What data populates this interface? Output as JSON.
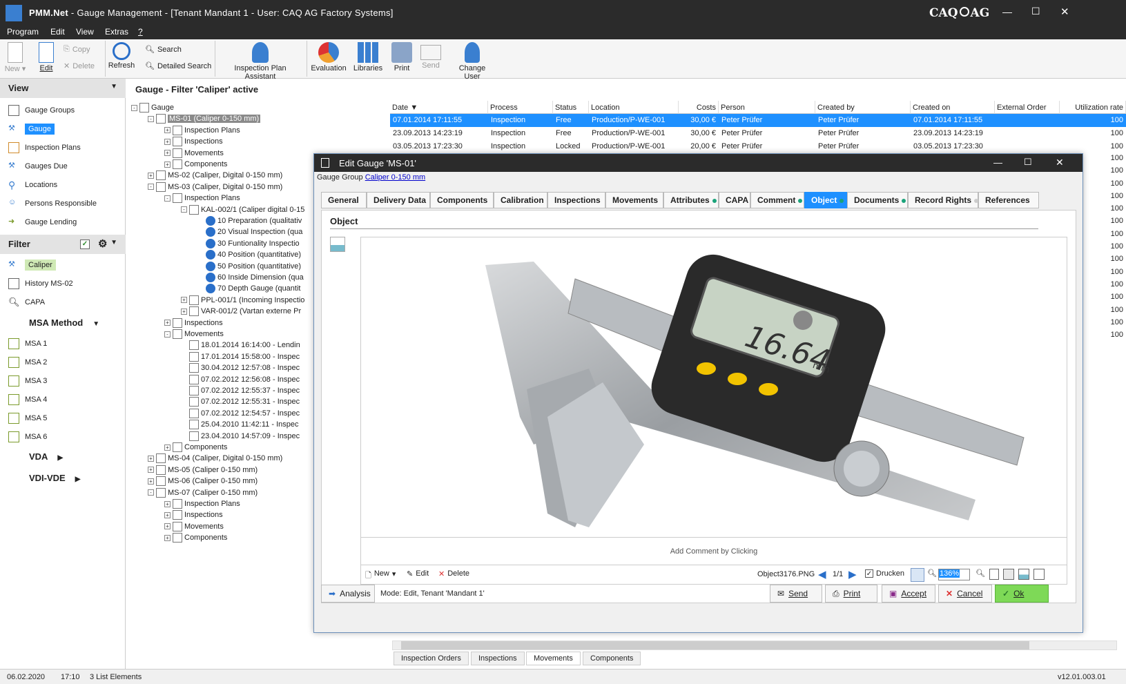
{
  "window": {
    "app": "PMM.Net",
    "title": " - Gauge Management - [Tenant Mandant 1 - User: CAQ AG Factory Systems]",
    "brand_left": "CAQ",
    "brand_right": "AG",
    "min": "—",
    "max": "☐",
    "close": "✕"
  },
  "menu": [
    "Program",
    "Edit",
    "View",
    "Extras",
    "?"
  ],
  "ribbon": {
    "new": "New",
    "edit": "Edit",
    "copy": "Copy",
    "delete": "Delete",
    "refresh": "Refresh",
    "search": "Search",
    "detailed_search": "Detailed Search",
    "assistant": "Inspection Plan Assistant",
    "evaluation": "Evaluation",
    "libraries": "Libraries",
    "print": "Print",
    "send": "Send",
    "change_user": "Change User"
  },
  "view_panel": {
    "title": "View",
    "items": [
      "Gauge Groups",
      "Gauge",
      "Inspection Plans",
      "Gauges Due",
      "Locations",
      "Persons Responsible",
      "Gauge Lending"
    ]
  },
  "filter_panel": {
    "title": "Filter",
    "items": [
      "Caliper",
      "History MS-02",
      "CAPA"
    ],
    "msa": "MSA Method",
    "msa_items": [
      "MSA 1",
      "MSA 2",
      "MSA 3",
      "MSA 4",
      "MSA 5",
      "MSA 6"
    ],
    "vda": "VDA",
    "vdi": "VDI-VDE"
  },
  "heading": "Gauge - Filter 'Caliper' active",
  "tree": [
    {
      "t": "Gauge",
      "l": 0,
      "ex": "-"
    },
    {
      "t": "MS-01 (Caliper 0-150 mm)",
      "l": 1,
      "ex": "-",
      "sel": true
    },
    {
      "t": "Inspection Plans",
      "l": 2,
      "ex": "+"
    },
    {
      "t": "Inspections",
      "l": 2,
      "ex": "+"
    },
    {
      "t": "Movements",
      "l": 2,
      "ex": "+"
    },
    {
      "t": "Components",
      "l": 2,
      "ex": "+"
    },
    {
      "t": "MS-02 (Caliper, Digital 0-150 mm)",
      "l": 1,
      "ex": "+"
    },
    {
      "t": "MS-03 (Caliper, Digital 0-150 mm)",
      "l": 1,
      "ex": "-"
    },
    {
      "t": "Inspection Plans",
      "l": 2,
      "ex": "-"
    },
    {
      "t": "KAL-002/1 (Caliper digital 0-15",
      "l": 3,
      "ex": "-"
    },
    {
      "t": "10 Preparation (qualitativ",
      "l": 4,
      "ex": ""
    },
    {
      "t": "20 Visual Inspection (qua",
      "l": 4,
      "ex": ""
    },
    {
      "t": "30 Funtionality Inspectio",
      "l": 4,
      "ex": ""
    },
    {
      "t": "40 Position (quantitative)",
      "l": 4,
      "ex": ""
    },
    {
      "t": "50 Position (quantitative)",
      "l": 4,
      "ex": ""
    },
    {
      "t": "60 Inside Dimension (qua",
      "l": 4,
      "ex": ""
    },
    {
      "t": "70 Depth Gauge (quantit",
      "l": 4,
      "ex": ""
    },
    {
      "t": "PPL-001/1 (Incoming Inspectio",
      "l": 3,
      "ex": "+"
    },
    {
      "t": "VAR-001/2 (Vartan externe Pr",
      "l": 3,
      "ex": "+"
    },
    {
      "t": "Inspections",
      "l": 2,
      "ex": "+"
    },
    {
      "t": "Movements",
      "l": 2,
      "ex": "-"
    },
    {
      "t": "18.01.2014 16:14:00 - Lendin",
      "l": 3,
      "ex": ""
    },
    {
      "t": "17.01.2014 15:58:00 - Inspec",
      "l": 3,
      "ex": ""
    },
    {
      "t": "30.04.2012 12:57:08 - Inspec",
      "l": 3,
      "ex": ""
    },
    {
      "t": "07.02.2012 12:56:08 - Inspec",
      "l": 3,
      "ex": ""
    },
    {
      "t": "07.02.2012 12:55:37 - Inspec",
      "l": 3,
      "ex": ""
    },
    {
      "t": "07.02.2012 12:55:31 - Inspec",
      "l": 3,
      "ex": ""
    },
    {
      "t": "07.02.2012 12:54:57 - Inspec",
      "l": 3,
      "ex": ""
    },
    {
      "t": "25.04.2010 11:42:11 - Inspec",
      "l": 3,
      "ex": ""
    },
    {
      "t": "23.04.2010 14:57:09 - Inspec",
      "l": 3,
      "ex": ""
    },
    {
      "t": "Components",
      "l": 2,
      "ex": "+"
    },
    {
      "t": "MS-04 (Caliper, Digital 0-150 mm)",
      "l": 1,
      "ex": "+"
    },
    {
      "t": "MS-05 (Caliper 0-150 mm)",
      "l": 1,
      "ex": "+"
    },
    {
      "t": "MS-06 (Caliper 0-150 mm)",
      "l": 1,
      "ex": "+"
    },
    {
      "t": "MS-07 (Caliper 0-150 mm)",
      "l": 1,
      "ex": "-"
    },
    {
      "t": "Inspection Plans",
      "l": 2,
      "ex": "+"
    },
    {
      "t": "Inspections",
      "l": 2,
      "ex": "+"
    },
    {
      "t": "Movements",
      "l": 2,
      "ex": "+"
    },
    {
      "t": "Components",
      "l": 2,
      "ex": "+"
    }
  ],
  "grid": {
    "columns": [
      "Date",
      "Process",
      "Status",
      "Location",
      "Costs",
      "Person",
      "Created by",
      "Created on",
      "External Order",
      "Utilization rate"
    ],
    "rows": [
      [
        "07.01.2014 17:11:55",
        "Inspection",
        "Free",
        "Production/P-WE-001",
        "30,00 €",
        "Peter Prüfer",
        "Peter Prüfer",
        "07.01.2014 17:11:55",
        "",
        "100"
      ],
      [
        "23.09.2013 14:23:19",
        "Inspection",
        "Free",
        "Production/P-WE-001",
        "30,00 €",
        "Peter Prüfer",
        "Peter Prüfer",
        "23.09.2013 14:23:19",
        "",
        "100"
      ],
      [
        "03.05.2013 17:23:30",
        "Inspection",
        "Locked",
        "Production/P-WE-001",
        "20,00 €",
        "Peter Prüfer",
        "Peter Prüfer",
        "03.05.2013 17:23:30",
        "",
        "100"
      ]
    ],
    "extra_util": [
      "100",
      "100",
      "100",
      "100",
      "100",
      "100",
      "100",
      "100",
      "100",
      "100",
      "100",
      "100",
      "100",
      "100",
      "100"
    ]
  },
  "bottom_tabs": [
    "Inspection Orders",
    "Inspections",
    "Movements",
    "Components"
  ],
  "status": {
    "date": "06.02.2020",
    "time": "17:10",
    "count": "3 List Elements",
    "version": "v12.01.003.01"
  },
  "dialog": {
    "title": "Edit Gauge 'MS-01'",
    "group_label": "Gauge Group",
    "group_link": "Caliper 0-150 mm",
    "tabs": [
      {
        "label": "General",
        "dot": ""
      },
      {
        "label": "Delivery Data",
        "dot": ""
      },
      {
        "label": "Components",
        "dot": ""
      },
      {
        "label": "Calibration",
        "dot": ""
      },
      {
        "label": "Inspections",
        "dot": ""
      },
      {
        "label": "Movements",
        "dot": ""
      },
      {
        "label": "Attributes",
        "dot": "#1aa37a"
      },
      {
        "label": "CAPA",
        "dot": ""
      },
      {
        "label": "Comment",
        "dot": "#1aa37a"
      },
      {
        "label": "Object",
        "dot": "#1aa37a",
        "active": true
      },
      {
        "label": "Documents",
        "dot": "#1aa37a"
      },
      {
        "label": "Record Rights",
        "dot": "#cccccc"
      },
      {
        "label": "References",
        "dot": ""
      }
    ],
    "section": "Object",
    "add_comment": "Add Comment by Clicking",
    "toolbar": {
      "new": "New",
      "edit": "Edit",
      "delete": "Delete",
      "file": "Object3176.PNG",
      "page": "1/1",
      "print_check": "Drucken",
      "zoom": "136%"
    },
    "display": "16.64",
    "display_unit": "mm",
    "footer": {
      "analysis": "Analysis",
      "mode": "Mode: Edit, Tenant 'Mandant 1'",
      "send": "Send",
      "print": "Print",
      "accept": "Accept",
      "cancel": "Cancel",
      "ok": "Ok"
    }
  },
  "colors": {
    "accent": "#1e90ff",
    "selected_green": "#cfe9b5",
    "ok_green": "#7ed957"
  }
}
